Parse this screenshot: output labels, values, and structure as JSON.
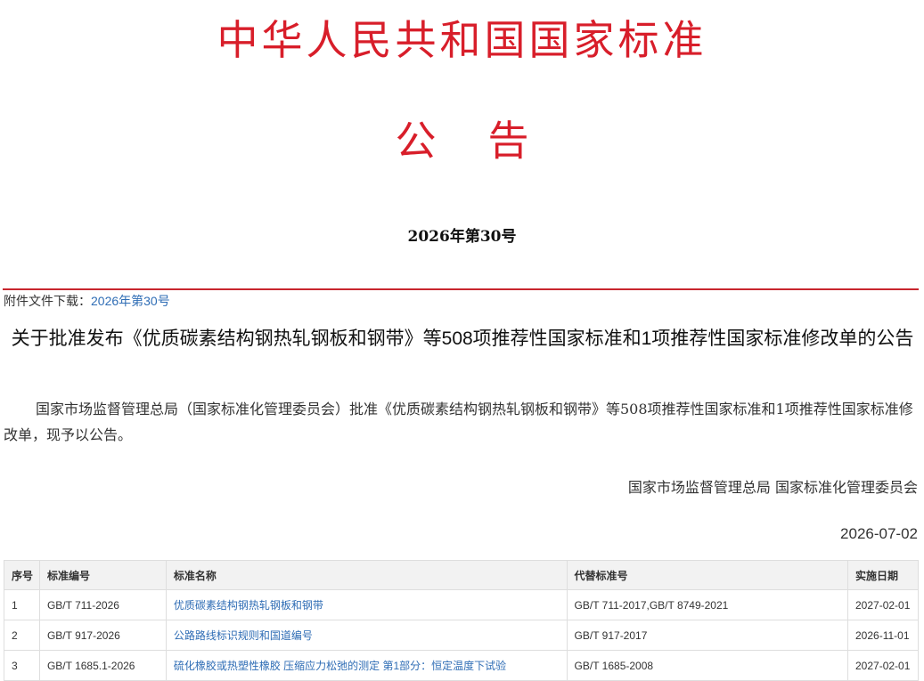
{
  "masthead": {
    "title": "中华人民共和国国家标准",
    "subtitle_chars": [
      "公",
      "告"
    ],
    "issue_number": "2026年第30号"
  },
  "attachment": {
    "label": "附件文件下载：",
    "link_text": "2026年第30号"
  },
  "notice": {
    "title": "关于批准发布《优质碳素结构钢热轧钢板和钢带》等508项推荐性国家标准和1项推荐性国家标准修改单的公告",
    "body": "国家市场监督管理总局（国家标准化管理委员会）批准《优质碳素结构钢热轧钢板和钢带》等508项推荐性国家标准和1项推荐性国家标准修改单，现予以公告。",
    "signer": "国家市场监督管理总局 国家标准化管理委员会",
    "date": "2026-07-02"
  },
  "table": {
    "headers": [
      "序号",
      "标准编号",
      "标准名称",
      "代替标准号",
      "实施日期"
    ],
    "rows": [
      {
        "no": "1",
        "code": "GB/T 711-2026",
        "name": "优质碳素结构钢热轧钢板和钢带",
        "replaces": "GB/T 711-2017,GB/T 8749-2021",
        "effective": "2027-02-01"
      },
      {
        "no": "2",
        "code": "GB/T 917-2026",
        "name": "公路路线标识规则和国道编号",
        "replaces": "GB/T 917-2017",
        "effective": "2026-11-01"
      },
      {
        "no": "3",
        "code": "GB/T 1685.1-2026",
        "name": "硫化橡胶或热塑性橡胶 压缩应力松弛的测定 第1部分：恒定温度下试验",
        "replaces": "GB/T 1685-2008",
        "effective": "2027-02-01"
      }
    ]
  },
  "colors": {
    "masthead_red": "#d81e2a",
    "rule_red": "#c8252e",
    "link_blue": "#2f6db5"
  }
}
